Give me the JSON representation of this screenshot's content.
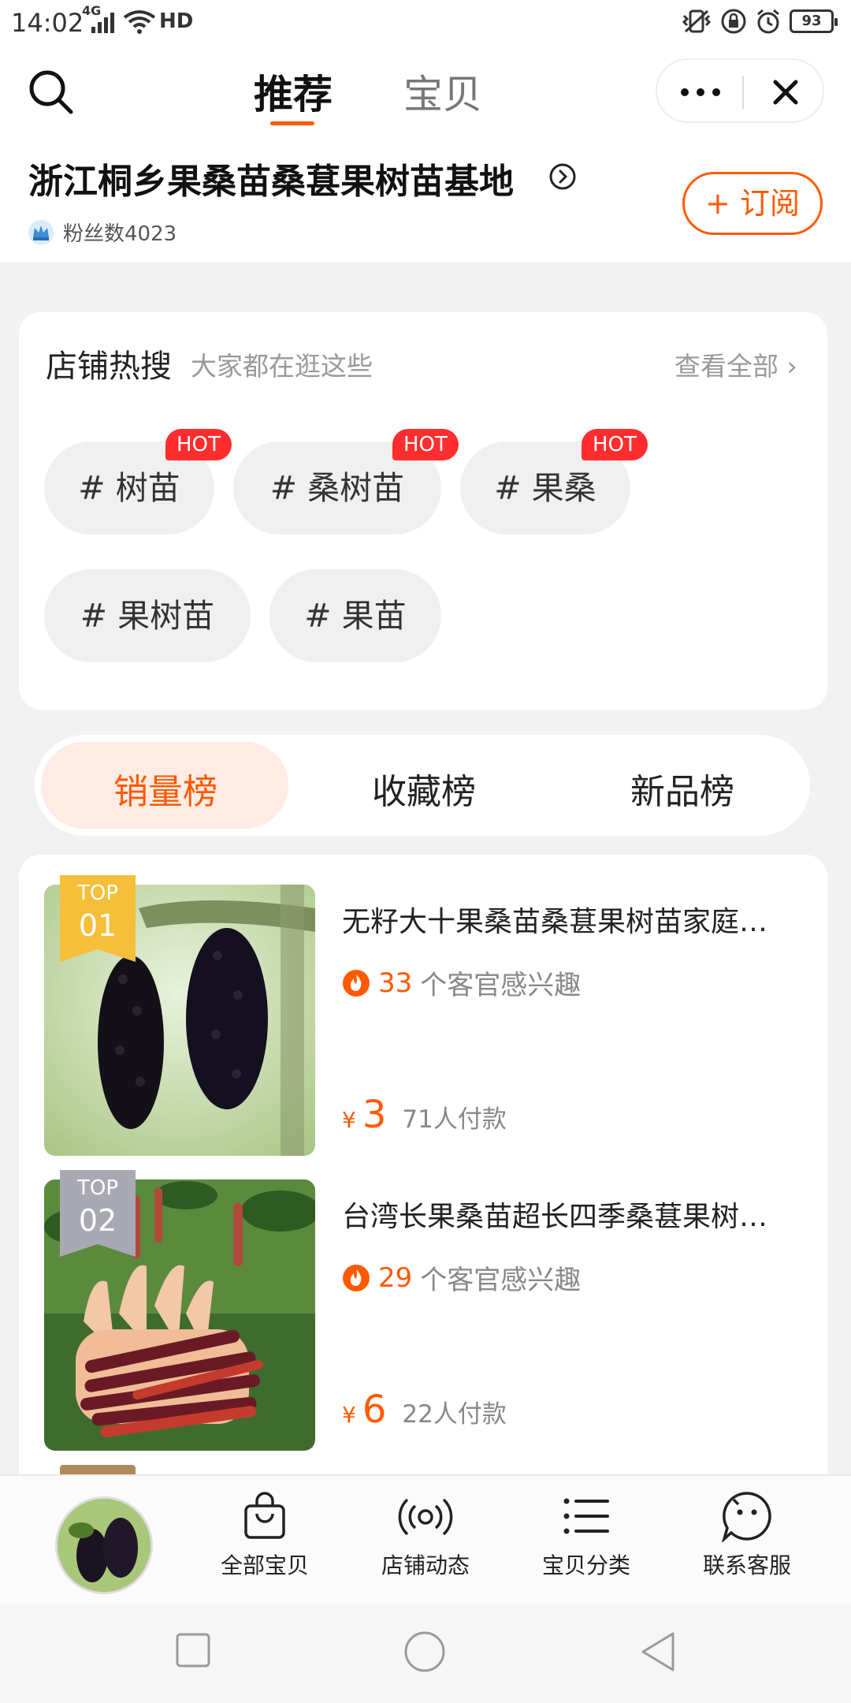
{
  "status_bar": {
    "time": "14:02",
    "network": "4G",
    "hd": "HD",
    "battery": "93"
  },
  "header": {
    "tabs": [
      {
        "label": "推荐",
        "active": true
      },
      {
        "label": "宝贝",
        "active": false
      }
    ],
    "shop_name": "浙江桐乡果桑苗桑葚果树苗基地",
    "fans": "粉丝数4023",
    "subscribe_label": "+ 订阅"
  },
  "hot_search": {
    "title": "店铺热搜",
    "subtitle": "大家都在逛这些",
    "view_all": "查看全部 ›",
    "hot_badge": "HOT",
    "tags": [
      {
        "label": "# 树苗",
        "hot": true
      },
      {
        "label": "# 桑树苗",
        "hot": true
      },
      {
        "label": "# 果桑",
        "hot": true
      },
      {
        "label": "# 果树苗",
        "hot": false
      },
      {
        "label": "# 果苗",
        "hot": false
      }
    ]
  },
  "ranking_tabs": [
    {
      "label": "销量榜",
      "active": true
    },
    {
      "label": "收藏榜",
      "active": false
    },
    {
      "label": "新品榜",
      "active": false
    }
  ],
  "products": [
    {
      "rank_label": "TOP",
      "rank": "01",
      "rank_color": "#f5bf3a",
      "title": "无籽大十果桑苗桑葚果树苗家庭…",
      "interest_count": "33",
      "interest_text": "个客官感兴趣",
      "currency": "¥",
      "price": "3",
      "paid": "71人付款"
    },
    {
      "rank_label": "TOP",
      "rank": "02",
      "rank_color": "#a9a9b4",
      "title": "台湾长果桑苗超长四季桑葚果树…",
      "interest_count": "29",
      "interest_text": "个客官感兴趣",
      "currency": "¥",
      "price": "6",
      "paid": "22人付款"
    }
  ],
  "bottom_nav": [
    {
      "label": "全部宝贝",
      "icon": "shopping-bag-icon"
    },
    {
      "label": "店铺动态",
      "icon": "broadcast-icon"
    },
    {
      "label": "宝贝分类",
      "icon": "list-icon"
    },
    {
      "label": "联系客服",
      "icon": "chat-face-icon"
    }
  ],
  "colors": {
    "accent": "#ff5a00",
    "hot_badge": "#ff2d2d",
    "active_tab_bg": "#ffece4"
  }
}
